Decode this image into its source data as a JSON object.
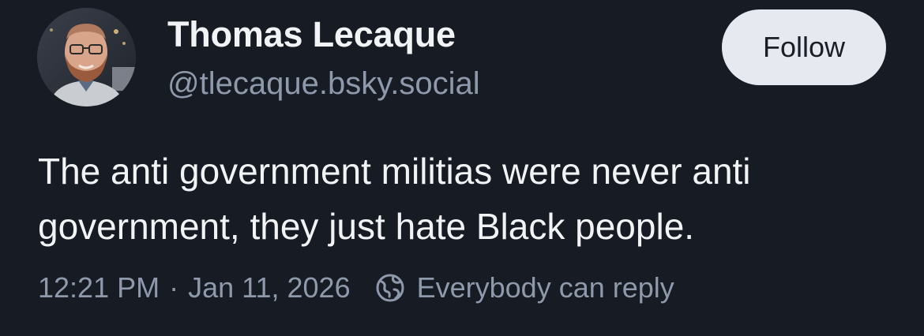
{
  "post": {
    "author": {
      "display_name": "Thomas Lecaque",
      "handle": "@tlecaque.bsky.social",
      "avatar_icon": "person-avatar"
    },
    "follow_label": "Follow",
    "text_lines": [
      "The anti government militias were never anti",
      "government, they just hate Black people."
    ],
    "time": "12:21 PM",
    "separator": "·",
    "date": "Jan 11, 2026",
    "reply_icon": "globe-icon",
    "reply_setting": "Everybody can reply"
  },
  "colors": {
    "background": "#171b24",
    "text_primary": "#f1f3f5",
    "text_secondary": "#8e9aab",
    "button_bg": "#e6e9f0",
    "button_text": "#1a1e27"
  }
}
